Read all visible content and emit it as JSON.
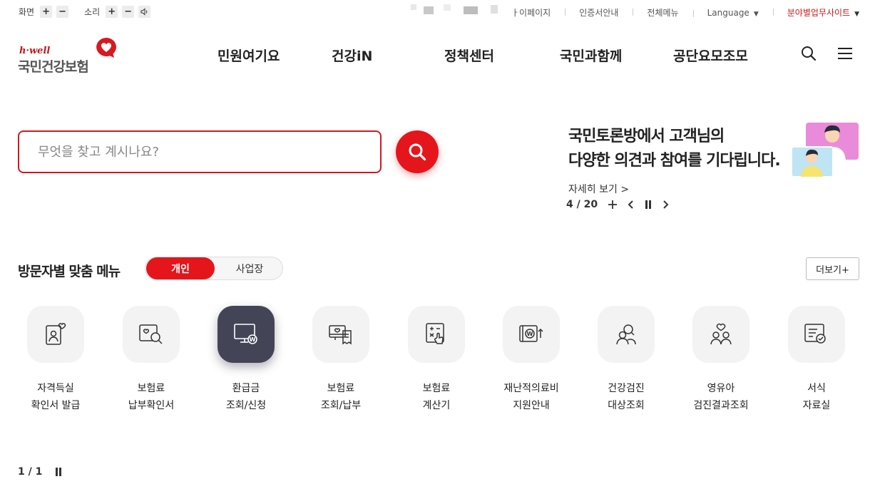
{
  "utility": {
    "screen_label": "화면",
    "sound_label": "소리",
    "plus": "+",
    "minus": "−",
    "links": [
      "ㅏ이페이지",
      "인증서안내",
      "전체메뉴",
      "Language",
      "분야별업무사이트"
    ]
  },
  "logo": {
    "brand": "h·well",
    "name": "국민건강보험"
  },
  "gnb": [
    "민원여기요",
    "건강iN",
    "정책센터",
    "국민과함께",
    "공단요모조모"
  ],
  "search": {
    "placeholder": "무엇을 찾고 계시나요?"
  },
  "promo": {
    "title_line1": "국민토론방에서 고객님의",
    "title_line2": "다양한 의견과 참여를 기다립니다.",
    "more": "자세히 보기",
    "counter": "4 / 20"
  },
  "menu_section": {
    "title": "방문자별 맞춤 메뉴",
    "toggle_on": "개인",
    "toggle_off": "사업장",
    "more": "더보기+",
    "items": [
      {
        "line1": "자격득실",
        "line2": "확인서 발급",
        "icon": "id-card-heart-icon"
      },
      {
        "line1": "보험료",
        "line2": "납부확인서",
        "icon": "doc-search-icon"
      },
      {
        "line1": "환급금",
        "line2": "조회/신청",
        "icon": "monitor-won-icon"
      },
      {
        "line1": "보험료",
        "line2": "조회/납부",
        "icon": "receipt-heart-icon"
      },
      {
        "line1": "보험료",
        "line2": "계산기",
        "icon": "calculator-hand-icon"
      },
      {
        "line1": "재난적의료비",
        "line2": "지원안내",
        "icon": "won-up-icon"
      },
      {
        "line1": "건강검진",
        "line2": "대상조회",
        "icon": "people-search-icon"
      },
      {
        "line1": "영유아",
        "line2": "검진결과조회",
        "icon": "family-heart-icon"
      },
      {
        "line1": "서식",
        "line2": "자료실",
        "icon": "form-check-icon"
      }
    ],
    "pager": "1 / 1"
  },
  "colors": {
    "accent": "#e4161c",
    "active_icon_bg": "#434557"
  }
}
